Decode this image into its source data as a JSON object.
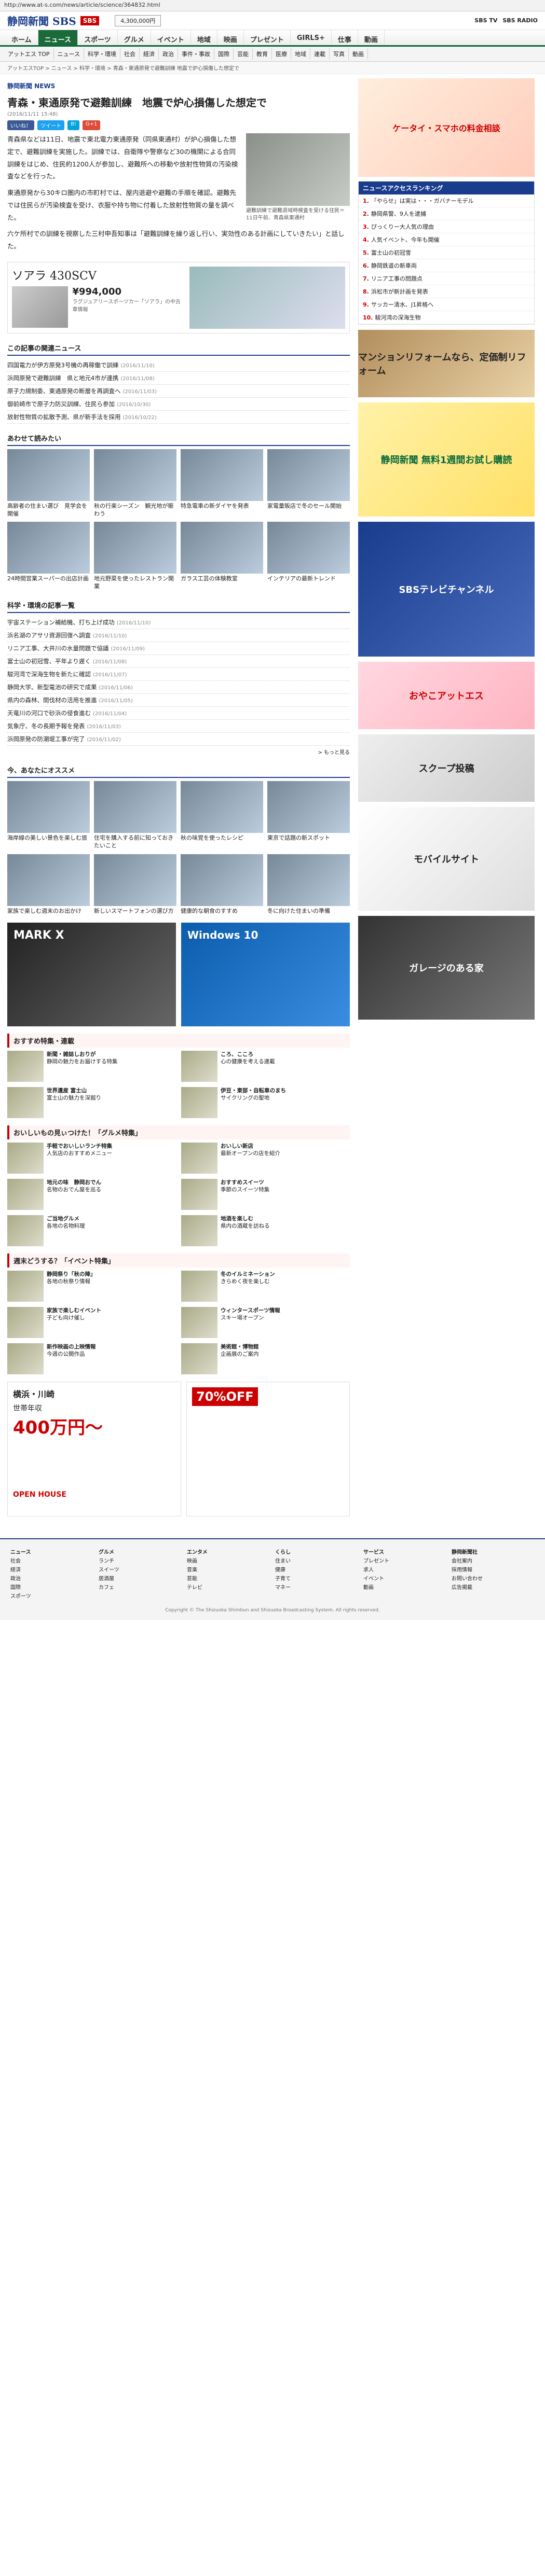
{
  "browser": {
    "url": "http://www.at-s.com/news/article/science/364832.html"
  },
  "header": {
    "logo": "静岡新聞 SBS",
    "hdr_box": "4,300,000円",
    "sbs_tv": "SBS TV",
    "sbs_radio": "SBS RADIO"
  },
  "nav": [
    "ホーム",
    "ニュース",
    "スポーツ",
    "グルメ",
    "イベント",
    "地域",
    "映画",
    "プレゼント",
    "GIRLS+",
    "仕事",
    "動画"
  ],
  "subnav": [
    "アットエス TOP",
    "ニュース",
    "科学・環境",
    "社会",
    "経済",
    "政治",
    "事件・事故",
    "国際",
    "芸能",
    "教育",
    "医療",
    "地域",
    "連載",
    "写真",
    "動画"
  ],
  "breadcrumb": "アットエスTOP > ニュース > 科学・環境 > 青森・東通原発で避難訓練 地震で炉心損傷した想定で",
  "article": {
    "kicker": "静岡新聞 NEWS",
    "title": "青森・東通原発で避難訓練　地震で炉心損傷した想定で",
    "date": "(2016/11/11 15:48)",
    "share": [
      "いいね！",
      "ツイート",
      "B!",
      "G+1"
    ],
    "photo_caption": "避難訓練で避難退域時検査を受ける住民＝11日午前、青森県東通村",
    "p1": "青森県などは11日、地震で東北電力東通原発（同県東通村）が炉心損傷した想定で、避難訓練を実施した。訓練では、自衛隊や警察など30の機関による合同訓練をはじめ、住民約1200人が参加し、避難所への移動や放射性物質の汚染検査などを行った。",
    "p2": "東通原発から30キロ圏内の市町村では、屋内退避や避難の手順を確認。避難先では住民らが汚染検査を受け、衣服や持ち物に付着した放射性物質の量を調べた。",
    "p3": "六ケ所村での訓練を視察した三村申吾知事は「避難訓練を繰り返し行い、実効性のある計画にしていきたい」と話した。"
  },
  "ad_car": {
    "name": "ソアラ 430SCV",
    "price": "¥994,000",
    "desc": "ラグジュアリースポーツカー「ソアラ」の中古車情報"
  },
  "related_title": "この記事の関連ニュース",
  "related": [
    {
      "t": "四国電力が伊方原発3号機の再稼働で訓練",
      "d": "(2016/11/10)"
    },
    {
      "t": "浜岡原発で避難訓練　県と地元4市が連携",
      "d": "(2016/11/08)"
    },
    {
      "t": "原子力規制委、東通原発の断層を再調査へ",
      "d": "(2016/11/03)"
    },
    {
      "t": "御前崎市で原子力防災訓練、住民ら参加",
      "d": "(2016/10/30)"
    },
    {
      "t": "放射性物質の拡散予測、県が新手法を採用",
      "d": "(2016/10/22)"
    }
  ],
  "read_title": "あわせて読みたい",
  "read": [
    {
      "t": "高齢者の住まい選び　見学会を開催"
    },
    {
      "t": "秋の行楽シーズン　観光地が賑わう"
    },
    {
      "t": "特急電車の新ダイヤを発表"
    },
    {
      "t": "家電量販店で冬のセール開始"
    },
    {
      "t": "24時間営業スーパーの出店計画"
    },
    {
      "t": "地元野菜を使ったレストラン開業"
    },
    {
      "t": "ガラス工芸の体験教室"
    },
    {
      "t": "インテリアの最新トレンド"
    }
  ],
  "sci_title": "科学・環境の記事一覧",
  "sci": [
    {
      "t": "宇宙ステーション補給機、打ち上げ成功",
      "d": "(2016/11/10)"
    },
    {
      "t": "浜名湖のアサリ資源回復へ調査",
      "d": "(2016/11/10)"
    },
    {
      "t": "リニア工事、大井川の水量問題で協議",
      "d": "(2016/11/09)"
    },
    {
      "t": "富士山の初冠雪、平年より遅く",
      "d": "(2016/11/08)"
    },
    {
      "t": "駿河湾で深海生物を新たに確認",
      "d": "(2016/11/07)"
    },
    {
      "t": "静岡大学、新型電池の研究で成果",
      "d": "(2016/11/06)"
    },
    {
      "t": "県内の森林、間伐材の活用を推進",
      "d": "(2016/11/05)"
    },
    {
      "t": "天竜川の河口で砂浜の侵食進む",
      "d": "(2016/11/04)"
    },
    {
      "t": "気象庁、冬の長期予報を発表",
      "d": "(2016/11/03)"
    },
    {
      "t": "浜岡原発の防潮堤工事が完了",
      "d": "(2016/11/02)"
    }
  ],
  "sci_more": "> もっと見る",
  "reco_title": "今、あなたにオススメ",
  "reco": [
    {
      "t": "海岸線の美しい景色を楽しむ旅"
    },
    {
      "t": "住宅を購入する前に知っておきたいこと"
    },
    {
      "t": "秋の味覚を使ったレシピ"
    },
    {
      "t": "東京で話題の新スポット"
    },
    {
      "t": "家族で楽しむ週末のお出かけ"
    },
    {
      "t": "新しいスマートフォンの選び方"
    },
    {
      "t": "健康的な朝食のすすめ"
    },
    {
      "t": "冬に向けた住まいの準備"
    }
  ],
  "ad_car2": "MARK X",
  "ad_pc": "Windows 10",
  "gourmet_title": "おいしいもの見ぃつけた！「グルメ特集」",
  "osusume_title": "おすすめ特集・連載",
  "event_title": "週末どうする？「イベント特集」",
  "tokushu": [
    {
      "t": "新聞・雑誌しおりが",
      "s": "静岡の魅力をお届けする特集"
    },
    {
      "t": "ころ、こころ",
      "s": "心の健康を考える連載"
    },
    {
      "t": "世界遺産 富士山",
      "s": "富士山の魅力を深掘り"
    },
    {
      "t": "伊豆・東部・自転車のまち",
      "s": "サイクリングの聖地"
    }
  ],
  "gourmet": [
    {
      "t": "手軽でおいしいランチ特集",
      "s": "人気店のおすすめメニュー"
    },
    {
      "t": "おいしい新店",
      "s": "最新オープンの店を紹介"
    },
    {
      "t": "地元の味　静岡おでん",
      "s": "名物のおでん屋を巡る"
    },
    {
      "t": "おすすめスイーツ",
      "s": "季節のスイーツ特集"
    },
    {
      "t": "ご当地グルメ",
      "s": "各地の名物料理"
    },
    {
      "t": "地酒を楽しむ",
      "s": "県内の酒蔵を訪ねる"
    }
  ],
  "events": [
    {
      "t": "静岡祭り「秋の陣」",
      "s": "各地の秋祭り情報"
    },
    {
      "t": "冬のイルミネーション",
      "s": "きらめく夜を楽しむ"
    },
    {
      "t": "家族で楽しむイベント",
      "s": "子ども向け催し"
    },
    {
      "t": "ウィンタースポーツ情報",
      "s": "スキー場オープン"
    },
    {
      "t": "新作映画の上映情報",
      "s": "今週の公開作品"
    },
    {
      "t": "美術館・博物館",
      "s": "企画展のご案内"
    }
  ],
  "ad_house": {
    "t1": "横浜・川崎",
    "t2": "世帯年収",
    "t3": "400万円～",
    "t4": "OPEN HOUSE"
  },
  "ad_sale": "70%OFF",
  "side": {
    "ad_top": "ケータイ・スマホの料金相談",
    "rank_title": "ニュースアクセスランキング",
    "rank": [
      "「やらせ」は実は・・・ガバナーモデル",
      "静岡県警、9人を逮捕",
      "ぴっくりー大人気の理由",
      "人気イベント、今年も開催",
      "富士山の初冠雪",
      "静岡鉄道の新車両",
      "リニア工事の問題点",
      "浜松市が新計画を発表",
      "サッカー清水、J1昇格へ",
      "駿河湾の深海生物"
    ],
    "banner1": "マンションリフォームなら、定価制リフォーム",
    "banner2": "静岡新聞 無料1週間お試し購読",
    "banner3": "SBSテレビチャンネル",
    "banner4": "おやこアットエス",
    "banner5": "スクープ投稿",
    "banner6": "モバイルサイト",
    "banner7": "ガレージのある家"
  },
  "footer": {
    "cols": [
      {
        "h": "ニュース",
        "items": [
          "社会",
          "経済",
          "政治",
          "国際",
          "スポーツ"
        ]
      },
      {
        "h": "グルメ",
        "items": [
          "ランチ",
          "スイーツ",
          "居酒屋",
          "カフェ"
        ]
      },
      {
        "h": "エンタメ",
        "items": [
          "映画",
          "音楽",
          "芸能",
          "テレビ"
        ]
      },
      {
        "h": "くらし",
        "items": [
          "住まい",
          "健康",
          "子育て",
          "マネー"
        ]
      },
      {
        "h": "サービス",
        "items": [
          "プレゼント",
          "求人",
          "イベント",
          "動画"
        ]
      },
      {
        "h": "静岡新聞社",
        "items": [
          "会社案内",
          "採用情報",
          "お問い合わせ",
          "広告掲載"
        ]
      }
    ],
    "copyright": "Copyright © The Shizuoka Shimbun and Shizuoka Broadcasting System. All rights reserved."
  }
}
